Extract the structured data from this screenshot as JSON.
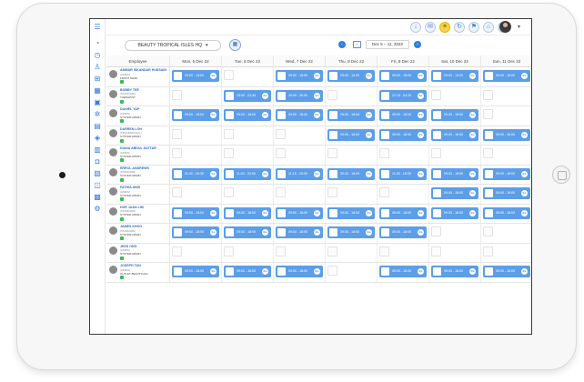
{
  "outlet": {
    "name": "BEAUTY TROPICAL ISLES HQ",
    "caret": "▾"
  },
  "date_range": "Dec 5 – 11, 2022",
  "columns": {
    "employee": "Employee",
    "days": [
      "Mon, 5 Dec 22",
      "Tue, 6 Dec 22",
      "Wed, 7 Dec 22",
      "Thu, 8 Dec 22",
      "Fri, 9 Dec 22",
      "Sat, 10 Dec 22",
      "Sun, 11 Dec 22"
    ]
  },
  "go_label": "Go",
  "employees": [
    {
      "name": "AMMAR ISKANDAR HUSSAIN",
      "sub": "(ADMIN)",
      "role": "FRONT DESK",
      "shifts": [
        "09:00 - 18:00",
        "",
        "09:00 - 18:00",
        "09:00 - 12:00",
        "09:00 - 18:00",
        "09:00 - 13:00",
        "09:00 - 18:00"
      ]
    },
    {
      "name": "BOBBY TEE",
      "sub": "(STANDARD)",
      "role": "THERAPIST",
      "shifts": [
        "",
        "15:00 - 23:45",
        "10:00 - 20:00",
        "",
        "22:15 - 04:15",
        "",
        ""
      ]
    },
    {
      "name": "DANIEL YAP",
      "sub": "(ADMIN)",
      "role": "SYSTEM ADMIN",
      "shifts": [
        "09:00 - 18:00",
        "09:00 - 18:00",
        "09:00 - 18:00",
        "09:00 - 18:00",
        "09:00 - 18:00",
        "09:00 - 18:00",
        ""
      ]
    },
    {
      "name": "DARREN LOH",
      "sub": "(PROFESSIONAL)",
      "role": "SYSTEM ADMIN",
      "shifts": [
        "",
        "",
        "",
        "09:00 - 18:00",
        "09:00 - 18:00",
        "09:00 - 18:00",
        "09:00 - 18:00"
      ]
    },
    {
      "name": "DIANA ABDUL SATTAR",
      "sub": "(ADMIN)",
      "role": "SYSTEM ADMIN",
      "shifts": [
        "",
        "",
        "",
        "",
        "",
        "",
        ""
      ]
    },
    {
      "name": "ERROL ANDREWS",
      "sub": "(STANDARD)",
      "role": "SYSTEM ADMIN",
      "shifts": [
        "11:00 - 20:30",
        "11:00 - 22:00",
        "11:15 - 20:00",
        "09:00 - 18:00",
        "11:00 - 18:30",
        "09:00 - 18:00",
        "09:00 - 18:00"
      ]
    },
    {
      "name": "FATHIA ANIS",
      "sub": "(ADMIN)",
      "role": "SYSTEM ADMIN",
      "shifts": [
        "",
        "",
        "",
        "",
        "",
        "09:00 - 18:00",
        "09:00 - 18:00"
      ]
    },
    {
      "name": "HOE JUAN LIM",
      "sub": "(STANDARD)",
      "role": "SYSTEM ADMIN",
      "shifts": [
        "09:00 - 18:00",
        "09:00 - 18:00",
        "09:00 - 18:00",
        "09:00 - 18:00",
        "09:00 - 18:00",
        "09:00 - 18:00",
        "09:00 - 18:00"
      ]
    },
    {
      "name": "JAMES KHOO",
      "sub": "(STANDARD)",
      "role": "SYSTEM ADMIN",
      "shifts": [
        "09:00 - 18:00",
        "09:00 - 18:00",
        "09:00 - 18:00",
        "09:00 - 18:00",
        "09:00 - 18:00",
        "",
        ""
      ]
    },
    {
      "name": "JESS ONG",
      "sub": "(ADMIN)",
      "role": "SYSTEM ADMIN",
      "shifts": [
        "",
        "",
        "",
        "",
        "",
        "",
        ""
      ]
    },
    {
      "name": "JOSEPH TAN",
      "sub": "(ADMIN)",
      "role": "OUTLET BEAUTICIAN",
      "shifts": [
        "09:00 - 18:00",
        "09:00 - 18:00",
        "09:00 - 18:00",
        "",
        "09:00 - 18:00",
        "09:00 - 18:00",
        "09:00 - 18:00"
      ]
    }
  ],
  "sidebar_icons": [
    "menu-icon",
    "dashboard-icon",
    "clock-icon",
    "user-icon",
    "cart-icon",
    "calendar-icon",
    "shifts-icon",
    "settings-icon",
    "briefcase-icon",
    "tag-icon",
    "report-icon",
    "lock-icon",
    "building-icon",
    "gift-icon",
    "chart-icon",
    "gear-icon"
  ],
  "topbar_icons": [
    "download-icon",
    "chat-icon",
    "lightbulb-icon",
    "sync-icon",
    "flag-icon",
    "shop-icon",
    "bell-icon"
  ],
  "colors": {
    "shift": "#5c9ee8",
    "accent": "#2f7de1",
    "name": "#2d6cc0"
  }
}
